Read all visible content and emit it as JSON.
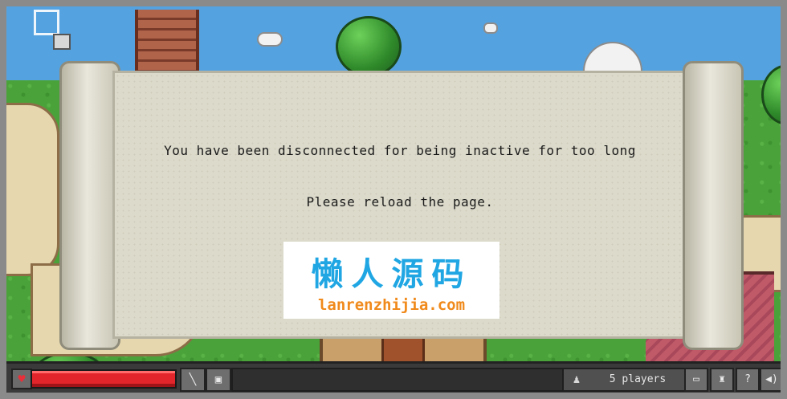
{
  "dialog": {
    "message": "You have been disconnected for being inactive for too long",
    "instruction": "Please reload the page."
  },
  "watermark": {
    "title": "懒人源码",
    "url": "lanrenzhijia.com"
  },
  "hud": {
    "health_fraction": 1.0,
    "player_count": "5 players",
    "icons": {
      "heart": "heart-icon",
      "weapon": "sword-icon",
      "armor": "armor-icon",
      "players": "players-icon",
      "chat": "chat-icon",
      "achievements": "trophy-icon",
      "help": "help-icon",
      "sound": "sound-icon"
    }
  },
  "colors": {
    "health": "#e2252b",
    "watermark_title": "#1fa6e3",
    "watermark_url": "#f08a1c"
  }
}
